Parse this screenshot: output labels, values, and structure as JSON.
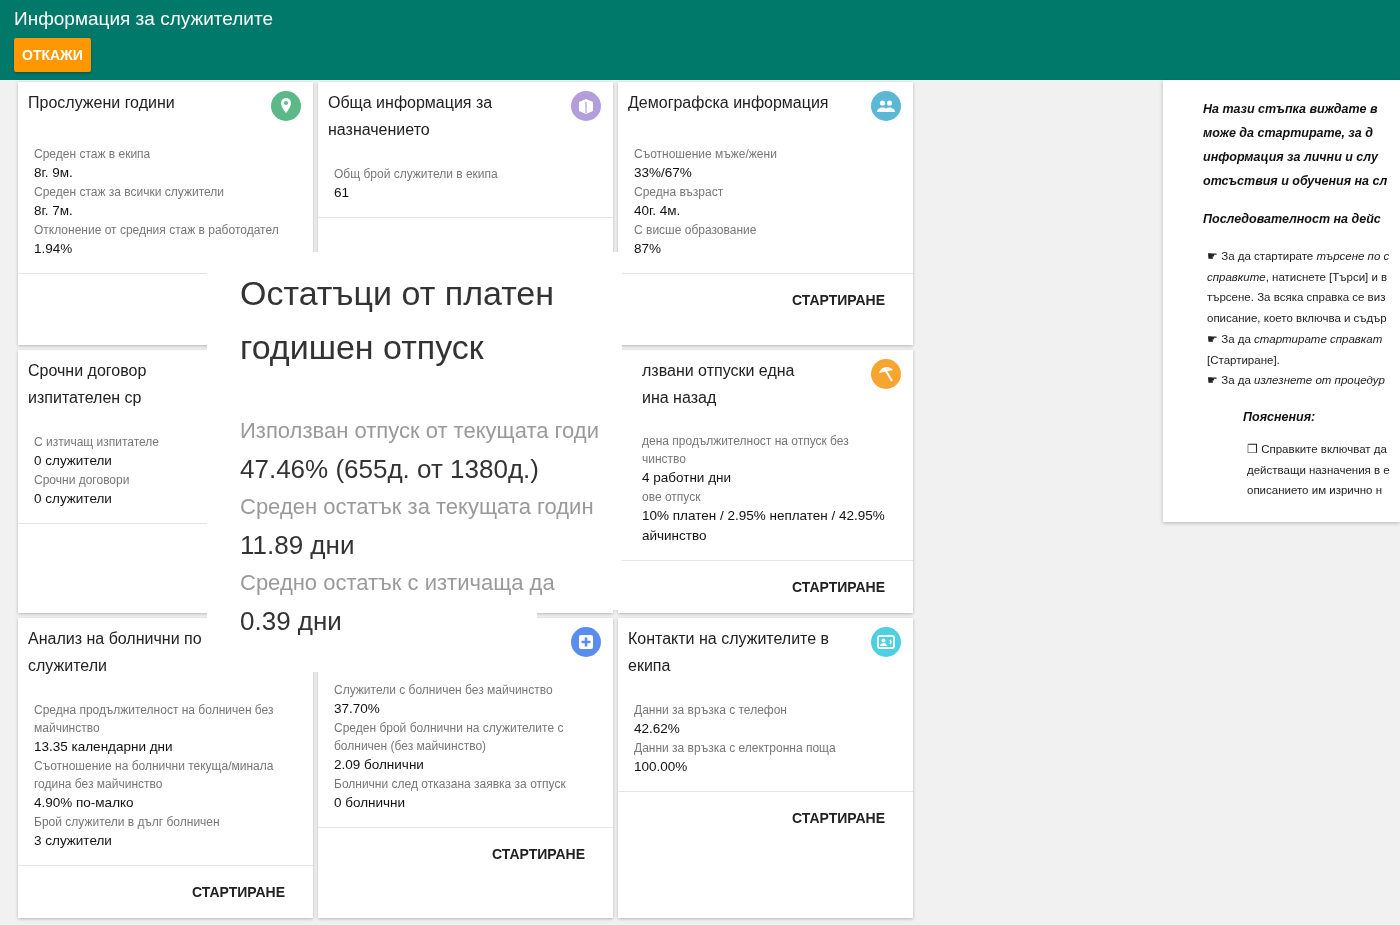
{
  "header": {
    "title": "Информация за служителите",
    "cancel_button": "ОТКАЖИ"
  },
  "cards": [
    {
      "title": "Прослужени години",
      "color": "#5cb887",
      "fields": [
        {
          "label": "Среден стаж в екипа",
          "value": "8г. 9м."
        },
        {
          "label": "Среден стаж за всички служители",
          "value": "8г. 7м."
        },
        {
          "label": "Отклонение от средния стаж в работодател",
          "value": "1.94%"
        }
      ]
    },
    {
      "title": "Обща информация за назначението",
      "color": "#b39ddb",
      "fields": [
        {
          "label": "Общ брой служители в екипа",
          "value": "61"
        }
      ]
    },
    {
      "title": "Демографска информация",
      "color": "#5bb8d4",
      "fields": [
        {
          "label": "Съотношение мъже/жени",
          "value": "33%/67%"
        },
        {
          "label": "Средна възраст",
          "value": "40г. 4м."
        },
        {
          "label": "С висше образование",
          "value": "87%"
        }
      ],
      "button": "СТАРТИРАНЕ"
    },
    {
      "title": "Срочни договор\nизпитателен ср",
      "fields": [
        {
          "label": "С изтичащ изпитателе",
          "value": "0 служители"
        },
        {
          "label": "Срочни договори",
          "value": "0 служители"
        }
      ]
    },
    {
      "title": "лзвани отпуски една\nина назад",
      "color": "#f7a531",
      "fields": [
        {
          "label": "дена продължителност на отпуск без\nчинство",
          "value": "4 работни дни"
        },
        {
          "label": "ове отпуск",
          "value": "10% платен / 2.95% неплатен / 42.95%\nайчинство"
        }
      ],
      "button": "СТАРТИРАНЕ"
    },
    {
      "title": "Анализ на болнични по служители",
      "fields": [
        {
          "label": "Средна продължителност на болничен без майчинство",
          "value": "13.35 календарни дни"
        },
        {
          "label": "Съотношение на болнични текуща/минала година без майчинство",
          "value": "4.90% по-малко"
        },
        {
          "label": "Брой служители в дълг болничен",
          "value": "3 служители"
        }
      ],
      "button": "СТАРТИРАНЕ"
    },
    {
      "color": "#5b8def",
      "fields": [
        {
          "label": "Служители с болничен без майчинство",
          "value": "37.70%"
        },
        {
          "label": "Среден брой болнични на служителите с болничен (без майчинство)",
          "value": "2.09 болнични"
        },
        {
          "label": "Болнични след отказана заявка за отпуск",
          "value": "0 болнични"
        }
      ],
      "button": "СТАРТИРАНЕ"
    },
    {
      "title": "Контакти на служителите в екипа",
      "color": "#4dd0e1",
      "fields": [
        {
          "label": "Данни за връзка с телефон",
          "value": "42.62%"
        },
        {
          "label": "Данни за връзка с електронна поща",
          "value": "100.00%"
        }
      ],
      "button": "СТАРТИРАНЕ"
    }
  ],
  "magnifier": {
    "title": "Остатъци от платен годишен отпуск",
    "fields": [
      {
        "label": "Използван отпуск от текущата годи",
        "value": "47.46% (655д. от 1380д.)"
      },
      {
        "label": "Среден остатък за текущата годин",
        "value": "11.89 дни"
      },
      {
        "label": "Средно остатък с изтичаща да",
        "value": "0.39 дни"
      }
    ]
  },
  "help": {
    "intro_lines": [
      "На тази стъпка виждате в",
      "може да стартирате, за д",
      "информация за лични и слу",
      "отсъствия и обучения на сл"
    ],
    "sequence_heading": "Последователност на дейс",
    "step_lines": [
      "☛ За да стартирате *търсене по с*",
      "*справките*, натиснете [Търси] и в",
      "търсене. За всяка справка се виз",
      "описание, което включва и съдър",
      "☛ За да *стартирате справкат*",
      "[Стартиране].",
      "☛ За да *излезнете от процедур*"
    ],
    "notes_heading": "Пояснения:",
    "note_lines": [
      "❐ Справките включват да",
      "действащи назначения в е",
      "описанието им изрично н"
    ]
  }
}
